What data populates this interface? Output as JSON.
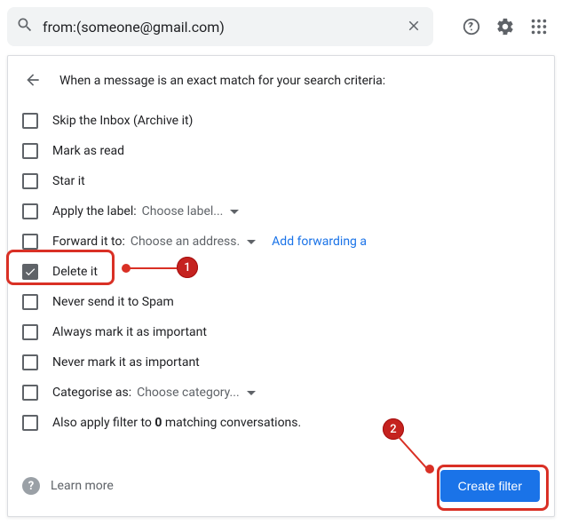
{
  "search": {
    "query": "from:(someone@gmail.com)"
  },
  "header": {
    "text": "When a message is an exact match for your search criteria:"
  },
  "actions": {
    "skipInbox": {
      "label": "Skip the Inbox (Archive it)",
      "checked": false
    },
    "markRead": {
      "label": "Mark as read",
      "checked": false
    },
    "starIt": {
      "label": "Star it",
      "checked": false
    },
    "applyLabel": {
      "label": "Apply the label:",
      "dropdown": "Choose label...",
      "checked": false
    },
    "forward": {
      "label": "Forward it to:",
      "dropdown": "Choose an address.",
      "link": "Add forwarding a",
      "checked": false
    },
    "deleteIt": {
      "label": "Delete it",
      "checked": true
    },
    "neverSpam": {
      "label": "Never send it to Spam",
      "checked": false
    },
    "alwaysImportant": {
      "label": "Always mark it as important",
      "checked": false
    },
    "neverImportant": {
      "label": "Never mark it as important",
      "checked": false
    },
    "categorise": {
      "label": "Categorise as:",
      "dropdown": "Choose category...",
      "checked": false
    },
    "alsoApply": {
      "prefix": "Also apply filter to ",
      "count": "0",
      "suffix": " matching conversations.",
      "checked": false
    }
  },
  "footer": {
    "learn": "Learn more",
    "createFilter": "Create filter"
  },
  "annotations": {
    "badge1": "1",
    "badge2": "2"
  }
}
